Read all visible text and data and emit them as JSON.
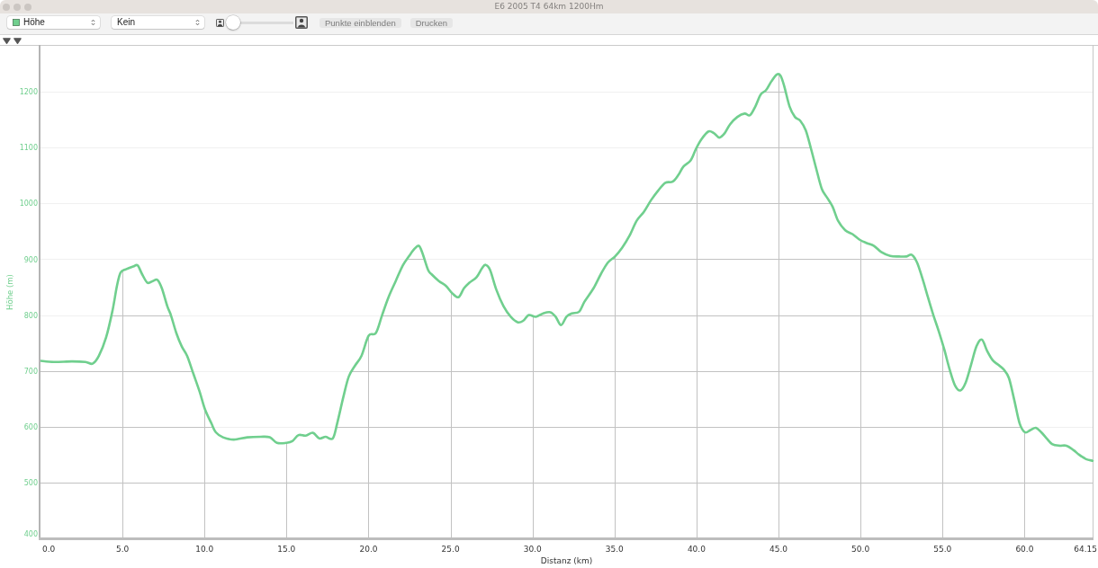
{
  "window": {
    "title": "E6 2005 T4 64km 1200Hm"
  },
  "toolbar": {
    "dropdowns": [
      {
        "value": "Höhe",
        "color": "#70cf8e"
      },
      {
        "value": "Kein"
      }
    ],
    "zoom_slider": {
      "level": 0
    },
    "buttons": [
      {
        "label": "Punkte einblenden",
        "disabled": true
      },
      {
        "label": "Drucken",
        "disabled": true
      }
    ]
  },
  "chart": {
    "chart_data": {
      "type": "line",
      "xlabel": "Distanz (km)",
      "ylabel": "Höhe (m)",
      "grid": true,
      "x": [
        0,
        0.82,
        1.92,
        2.74,
        3.18,
        3.56,
        4.0,
        4.39,
        4.66,
        4.88,
        5.21,
        5.65,
        5.92,
        6.2,
        6.52,
        6.85,
        7.13,
        7.4,
        7.73,
        7.95,
        8.28,
        8.61,
        8.94,
        9.32,
        9.7,
        10.03,
        10.42,
        10.69,
        11.13,
        11.79,
        12.61,
        13.43,
        13.98,
        14.42,
        14.97,
        15.35,
        15.73,
        16.17,
        16.61,
        17.0,
        17.38,
        17.82,
        18.09,
        18.48,
        18.8,
        19.19,
        19.57,
        20.01,
        20.45,
        20.83,
        21.22,
        21.66,
        22.09,
        22.48,
        22.81,
        23.08,
        23.3,
        23.63,
        23.85,
        24.29,
        24.73,
        25.11,
        25.49,
        25.82,
        26.15,
        26.59,
        26.92,
        27.14,
        27.41,
        27.8,
        28.23,
        28.67,
        29.11,
        29.44,
        29.77,
        30.21,
        30.65,
        31.09,
        31.41,
        31.74,
        32.07,
        32.4,
        32.84,
        33.17,
        33.72,
        34.16,
        34.59,
        35.03,
        35.47,
        35.91,
        36.35,
        36.79,
        37.23,
        37.66,
        38.1,
        38.54,
        38.87,
        39.2,
        39.64,
        39.97,
        40.3,
        40.73,
        41.06,
        41.39,
        41.72,
        42.05,
        42.49,
        42.93,
        43.26,
        43.59,
        43.91,
        44.24,
        44.57,
        44.9,
        45.12,
        45.34,
        45.67,
        46.0,
        46.33,
        46.66,
        46.98,
        47.31,
        47.64,
        47.97,
        48.3,
        48.63,
        49.07,
        49.51,
        49.95,
        50.38,
        50.82,
        51.26,
        51.81,
        52.36,
        52.8,
        53.13,
        53.45,
        53.78,
        54.11,
        54.44,
        54.77,
        55.1,
        55.43,
        55.76,
        56.09,
        56.41,
        56.74,
        57.07,
        57.4,
        57.73,
        58.06,
        58.39,
        58.72,
        59.05,
        59.38,
        59.7,
        60.03,
        60.36,
        60.69,
        61.02,
        61.35,
        61.68,
        62.12,
        62.56,
        62.99,
        63.32,
        63.75,
        64.15
      ],
      "series": [
        {
          "color": "#70cf8e",
          "values": [
            718,
            716,
            717,
            716,
            713,
            727,
            760,
            808,
            852,
            876,
            882,
            887,
            889,
            873,
            858,
            861,
            863,
            848,
            816,
            800,
            768,
            744,
            727,
            695,
            663,
            631,
            606,
            590,
            581,
            577,
            581,
            582,
            581,
            571,
            571,
            574,
            585,
            584,
            589,
            579,
            582,
            579,
            606,
            655,
            690,
            710,
            727,
            763,
            768,
            800,
            832,
            861,
            889,
            906,
            919,
            924,
            910,
            881,
            873,
            861,
            852,
            839,
            832,
            848,
            858,
            868,
            884,
            890,
            881,
            845,
            816,
            797,
            787,
            790,
            800,
            797,
            803,
            805,
            797,
            782,
            797,
            803,
            806,
            824,
            848,
            873,
            894,
            905,
            921,
            942,
            969,
            985,
            1006,
            1023,
            1037,
            1039,
            1050,
            1066,
            1077,
            1098,
            1115,
            1129,
            1126,
            1118,
            1126,
            1142,
            1155,
            1161,
            1158,
            1174,
            1195,
            1203,
            1219,
            1231,
            1229,
            1211,
            1174,
            1155,
            1148,
            1131,
            1098,
            1061,
            1026,
            1010,
            994,
            969,
            952,
            945,
            935,
            929,
            924,
            913,
            906,
            905,
            905,
            908,
            894,
            865,
            832,
            800,
            771,
            739,
            703,
            674,
            665,
            679,
            711,
            744,
            756,
            735,
            719,
            711,
            703,
            687,
            647,
            606,
            590,
            594,
            598,
            590,
            579,
            569,
            566,
            566,
            558,
            550,
            542,
            539
          ]
        }
      ],
      "xlim": [
        0,
        64.15
      ],
      "ylim": [
        400,
        1284
      ],
      "xticks": [
        {
          "value": 0,
          "label": "0.0"
        },
        {
          "value": 5,
          "label": "5.0"
        },
        {
          "value": 10,
          "label": "10.0"
        },
        {
          "value": 15,
          "label": "15.0"
        },
        {
          "value": 20,
          "label": "20.0"
        },
        {
          "value": 25,
          "label": "25.0"
        },
        {
          "value": 30,
          "label": "30.0"
        },
        {
          "value": 35,
          "label": "35.0"
        },
        {
          "value": 40,
          "label": "40.0"
        },
        {
          "value": 45,
          "label": "45.0"
        },
        {
          "value": 50,
          "label": "50.0"
        },
        {
          "value": 55,
          "label": "55.0"
        },
        {
          "value": 60,
          "label": "60.0"
        },
        {
          "value": 64.15,
          "label": "64.15"
        }
      ],
      "yticks": [
        400,
        500,
        600,
        700,
        800,
        900,
        1000,
        1100,
        1200
      ]
    }
  }
}
